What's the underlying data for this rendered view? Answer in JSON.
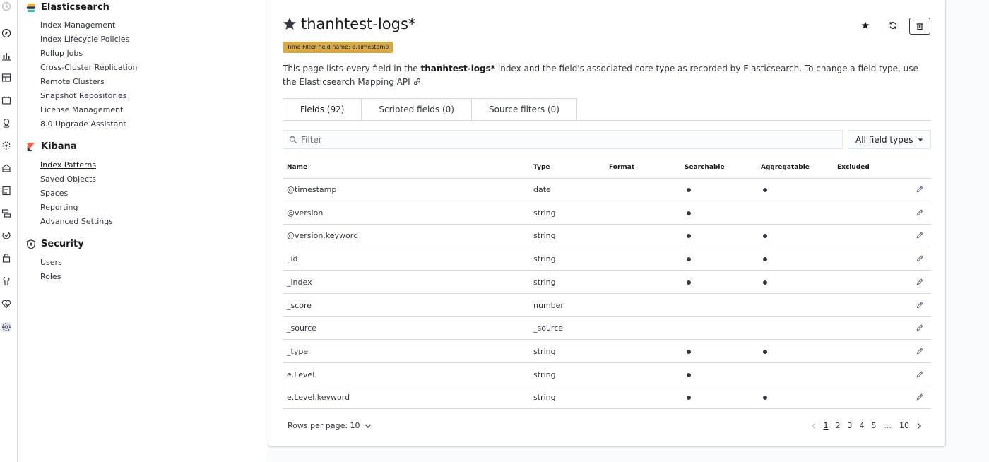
{
  "rail": {
    "icons": [
      "clock-icon",
      "compass-icon",
      "visualize-icon",
      "dashboard-icon",
      "canvas-icon",
      "maps-icon",
      "ml-icon",
      "infra-icon",
      "logs-icon",
      "apm-icon",
      "uptime-icon",
      "siem-icon",
      "dev-tools-icon",
      "monitoring-icon",
      "management-icon"
    ]
  },
  "sidebar": {
    "elasticsearch": {
      "title": "Elasticsearch",
      "items": [
        "Index Management",
        "Index Lifecycle Policies",
        "Rollup Jobs",
        "Cross-Cluster Replication",
        "Remote Clusters",
        "Snapshot Repositories",
        "License Management",
        "8.0 Upgrade Assistant"
      ]
    },
    "kibana": {
      "title": "Kibana",
      "items": [
        "Index Patterns",
        "Saved Objects",
        "Spaces",
        "Reporting",
        "Advanced Settings"
      ]
    },
    "security": {
      "title": "Security",
      "items": [
        "Users",
        "Roles"
      ]
    }
  },
  "page": {
    "title": "thanhtest-logs*",
    "time_filter_badge": "Time Filter field name: e.Timestamp",
    "description_prefix": "This page lists every field in the ",
    "description_bold": "thanhtest-logs*",
    "description_suffix": " index and the field's associated core type as recorded by Elasticsearch. To change a field type, use the Elasticsearch ",
    "description_link": "Mapping API",
    "tabs": [
      {
        "label": "Fields (92)"
      },
      {
        "label": "Scripted fields (0)"
      },
      {
        "label": "Source filters (0)"
      }
    ],
    "filter_placeholder": "Filter",
    "field_type_select": "All field types"
  },
  "table": {
    "columns": {
      "name": "Name",
      "type": "Type",
      "format": "Format",
      "searchable": "Searchable",
      "aggregatable": "Aggregatable",
      "excluded": "Excluded"
    },
    "rows": [
      {
        "name": "@timestamp",
        "type": "date",
        "searchable": true,
        "aggregatable": true
      },
      {
        "name": "@version",
        "type": "string",
        "searchable": true,
        "aggregatable": false
      },
      {
        "name": "@version.keyword",
        "type": "string",
        "searchable": true,
        "aggregatable": true
      },
      {
        "name": "_id",
        "type": "string",
        "searchable": true,
        "aggregatable": true
      },
      {
        "name": "_index",
        "type": "string",
        "searchable": true,
        "aggregatable": true
      },
      {
        "name": "_score",
        "type": "number",
        "searchable": false,
        "aggregatable": false
      },
      {
        "name": "_source",
        "type": "_source",
        "searchable": false,
        "aggregatable": false
      },
      {
        "name": "_type",
        "type": "string",
        "searchable": true,
        "aggregatable": true
      },
      {
        "name": "e.Level",
        "type": "string",
        "searchable": true,
        "aggregatable": false
      },
      {
        "name": "e.Level.keyword",
        "type": "string",
        "searchable": true,
        "aggregatable": true
      }
    ]
  },
  "pagination": {
    "rows_per_page": "Rows per page: 10",
    "pages": [
      "1",
      "2",
      "3",
      "4",
      "5"
    ],
    "ellipsis": "...",
    "last_page": "10",
    "current_page": "1"
  }
}
